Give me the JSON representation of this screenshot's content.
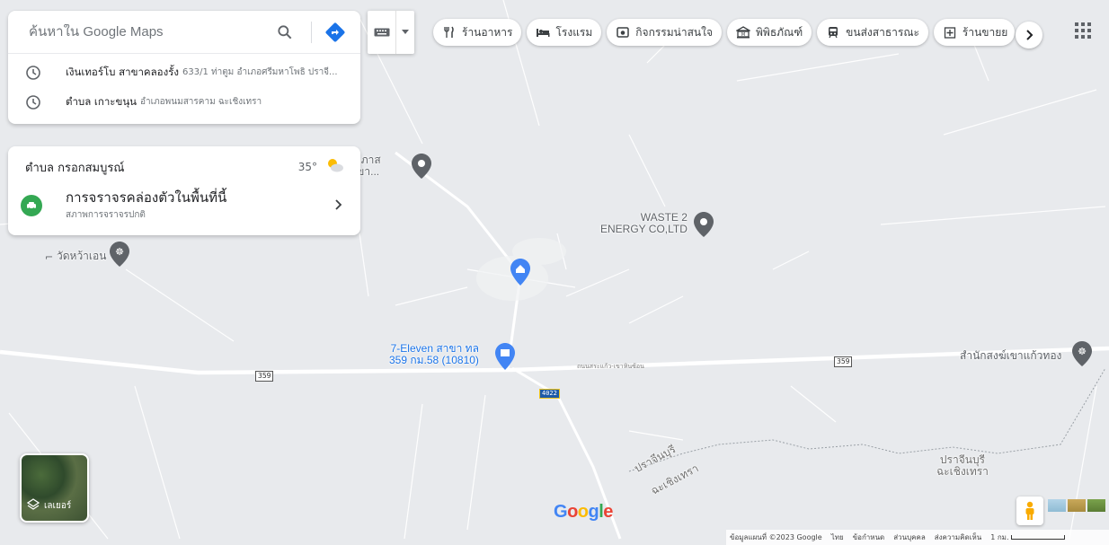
{
  "search": {
    "placeholder": "ค้นหาใน Google Maps"
  },
  "history": [
    {
      "main": "เงินเทอร์โบ สาขาคลองรั้ง",
      "sub": "633/1 ท่าตูม อำเภอศรีมหาโพธิ ปราจี..."
    },
    {
      "main": "ตำบล เกาะขนุน",
      "sub": "อำเภอพนมสารคาม ฉะเชิงเทรา"
    }
  ],
  "weather": {
    "location": "ตำบล กรอกสมบูรณ์",
    "temp": "35°"
  },
  "traffic": {
    "title": "การจราจรคล่องตัวในพื้นที่นี้",
    "subtitle": "สภาพการจราจรปกติ"
  },
  "chips": [
    {
      "label": "ร้านอาหาร",
      "icon": "restaurant-icon"
    },
    {
      "label": "โรงแรม",
      "icon": "hotel-icon"
    },
    {
      "label": "กิจกรรมน่าสนใจ",
      "icon": "camera-icon"
    },
    {
      "label": "พิพิธภัณฑ์",
      "icon": "museum-icon"
    },
    {
      "label": "ขนส่งสาธารณะ",
      "icon": "transit-icon"
    },
    {
      "label": "ร้านขายย",
      "icon": "pharmacy-icon"
    }
  ],
  "map_labels": {
    "poi_top": "ธังประภาส\nด (สาขา...",
    "waste": "WASTE 2\nENERGY CO,LTD",
    "temple_left": "วัดหว้าเอน",
    "seven_eleven": "7-Eleven สาขา ทล\n359 กม.58 (10810)",
    "temple_right": "สำนักสงฆ์เขาแก้วทอง",
    "road_name": "ถนนสระแก้ว-เขาหินซ้อน",
    "province_a": "ปราจีนบุรี",
    "province_b": "ฉะเชิงเทรา",
    "province_c": "ปราจีนบุรี\nฉะเชิงเทรา",
    "route_359": "359",
    "route_4022": "4022"
  },
  "layers": {
    "label": "เลเยอร์"
  },
  "logo": "Google",
  "footer": {
    "data": "ข้อมูลแผนที่ ©2023 Google",
    "lang": "ไทย",
    "terms": "ข้อกำหนด",
    "privacy": "ส่วนบุคคล",
    "feedback": "ส่งความคิดเห็น",
    "scale": "1 กม."
  },
  "colors": {
    "accent": "#1a73e8",
    "traffic_green": "#34a853",
    "map_bg": "#e8eaed"
  }
}
